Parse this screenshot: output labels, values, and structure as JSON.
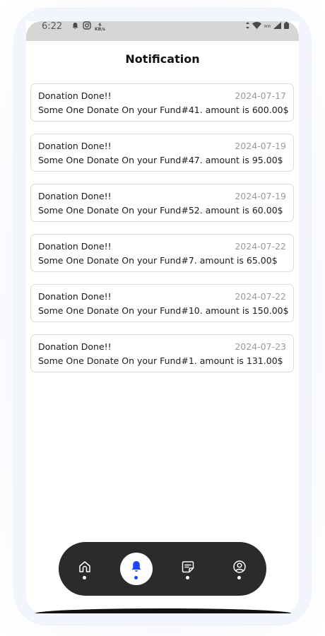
{
  "status_bar": {
    "time": "6:22",
    "net_speed_value": "6",
    "net_speed_unit": "KB/s",
    "net_type": "Wifi"
  },
  "header": {
    "title": "Notification"
  },
  "notifications": [
    {
      "title": "Donation Done!!",
      "date": "2024-07-17",
      "message": "Some One Donate On your Fund#41. amount is 600.00$"
    },
    {
      "title": "Donation Done!!",
      "date": "2024-07-19",
      "message": "Some One Donate On your Fund#47. amount is 95.00$"
    },
    {
      "title": "Donation Done!!",
      "date": "2024-07-19",
      "message": "Some One Donate On your Fund#52. amount is 60.00$"
    },
    {
      "title": "Donation Done!!",
      "date": "2024-07-22",
      "message": "Some One Donate On your Fund#7. amount is 65.00$"
    },
    {
      "title": "Donation Done!!",
      "date": "2024-07-22",
      "message": "Some One Donate On your Fund#10. amount is 150.00$"
    },
    {
      "title": "Donation Done!!",
      "date": "2024-07-23",
      "message": "Some One Donate On your Fund#1. amount is 131.00$"
    }
  ],
  "bottom_nav": {
    "items": [
      {
        "icon": "home-icon",
        "active": false
      },
      {
        "icon": "bell-icon",
        "active": true
      },
      {
        "icon": "note-icon",
        "active": false
      },
      {
        "icon": "profile-icon",
        "active": false
      }
    ],
    "active_color": "#1a47ff",
    "bar_color": "#2b2b2e"
  }
}
